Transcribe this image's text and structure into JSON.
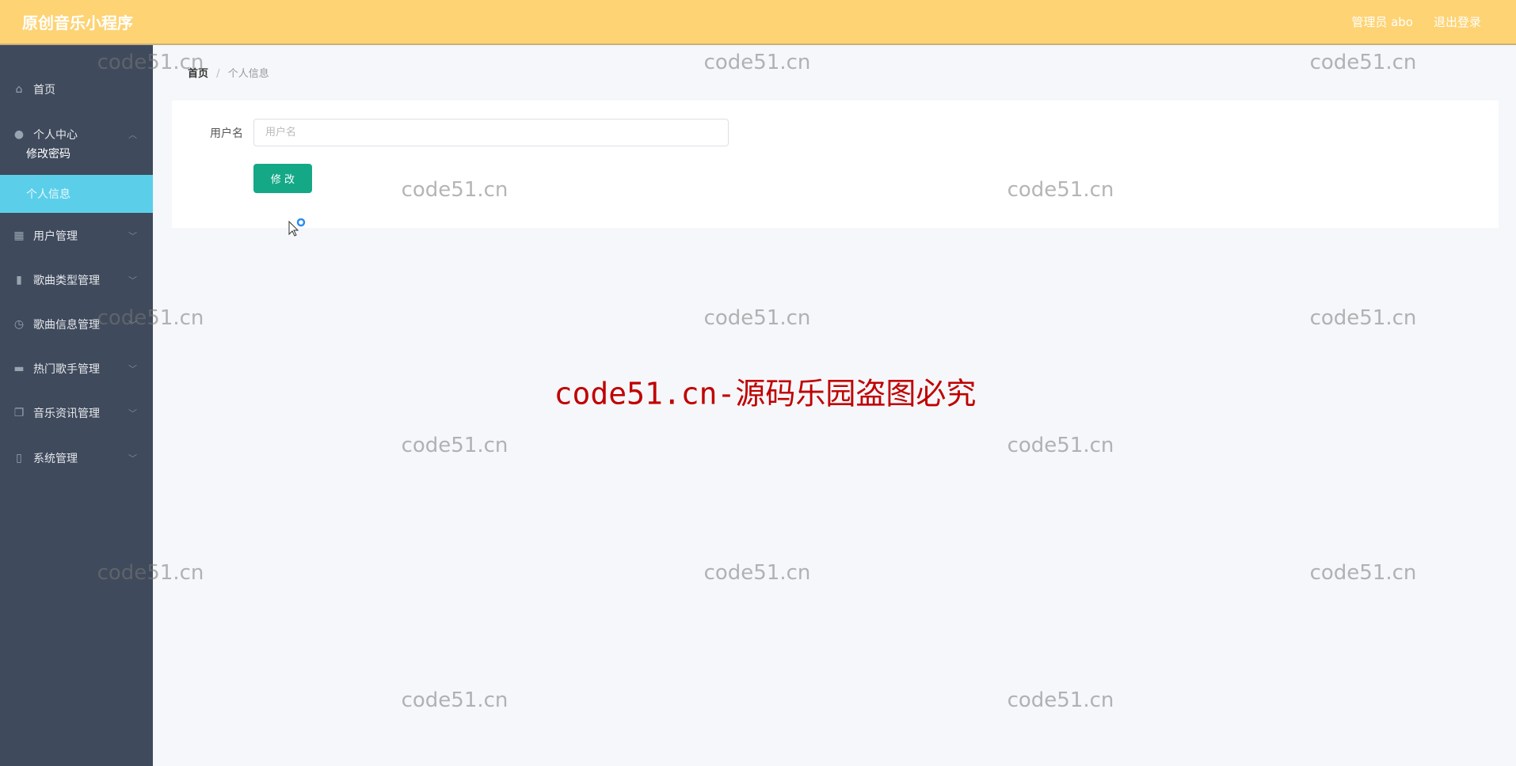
{
  "header": {
    "title": "原创音乐小程序",
    "user": "管理员 abo",
    "logout": "退出登录"
  },
  "sidebar": {
    "items": [
      {
        "label": "首页",
        "icon": "home-icon"
      },
      {
        "label": "个人中心",
        "icon": "user-icon",
        "expanded": true,
        "children": [
          {
            "label": "修改密码"
          },
          {
            "label": "个人信息",
            "active": true
          }
        ]
      },
      {
        "label": "用户管理",
        "icon": "grid-icon"
      },
      {
        "label": "歌曲类型管理",
        "icon": "bar-chart-icon"
      },
      {
        "label": "歌曲信息管理",
        "icon": "compass-icon"
      },
      {
        "label": "热门歌手管理",
        "icon": "briefcase-icon"
      },
      {
        "label": "音乐资讯管理",
        "icon": "copy-icon"
      },
      {
        "label": "系统管理",
        "icon": "mic-icon"
      }
    ]
  },
  "breadcrumb": {
    "home": "首页",
    "sep": "/",
    "current": "个人信息"
  },
  "form": {
    "username_label": "用户名",
    "username_placeholder": "用户名",
    "username_value": "",
    "submit": "修 改"
  },
  "watermark": {
    "text": "code51.cn",
    "banner": "code51.cn-源码乐园盗图必究"
  },
  "colors": {
    "header": "#fdd374",
    "sidebar": "#3f4a5c",
    "active": "#5bcfea",
    "button": "#14a887",
    "banner": "#c00000"
  }
}
